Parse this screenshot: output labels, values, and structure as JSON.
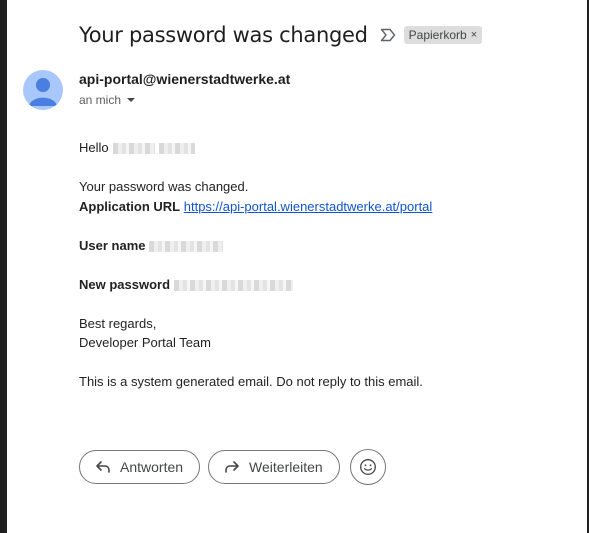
{
  "email": {
    "subject": "Your password was changed",
    "label": "Papierkorb",
    "label_remove": "×",
    "sender": "api-portal@wienerstadtwerke.at",
    "recipient": "an mich",
    "avatar_color": "#a8c7fa"
  },
  "body": {
    "greeting": "Hello",
    "line_changed": "Your password was changed.",
    "app_url_label": "Application URL",
    "app_url": "https://api-portal.wienerstadtwerke.at/portal",
    "user_name_label": "User name",
    "new_password_label": "New password",
    "regards": "Best regards,",
    "team": "Developer Portal Team",
    "footer_note": "This is a system generated email. Do not reply to this email."
  },
  "actions": {
    "reply_label": "Antworten",
    "forward_label": "Weiterleiten",
    "reply_icon": "reply-icon",
    "forward_icon": "forward-icon",
    "emoji_icon": "emoji-icon"
  },
  "colors": {
    "link": "#1155cc",
    "chip_bg": "#dddddd"
  }
}
